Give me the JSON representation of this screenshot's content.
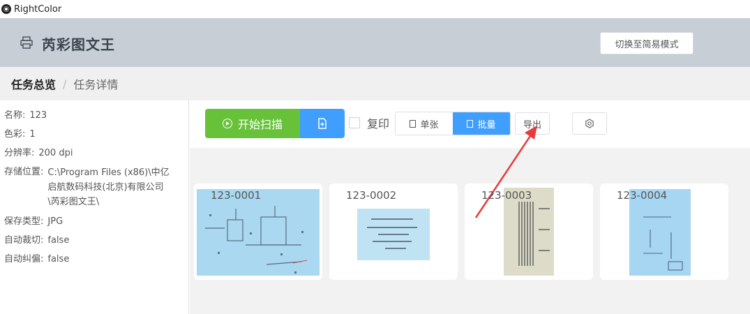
{
  "window": {
    "title": "RightColor"
  },
  "header": {
    "brand": "芮彩图文王",
    "mode_button": "切换至简易模式"
  },
  "breadcrumb": {
    "active": "任务总览",
    "separator": "/",
    "current": "任务详情"
  },
  "task_info": {
    "name_label": "名称:",
    "name_value": "123",
    "color_label": "色彩:",
    "color_value": "1",
    "resolution_label": "分辨率:",
    "resolution_value": "200 dpi",
    "storage_label": "存储位置:",
    "storage_value": "C:\\Program Files (x86)\\中亿启航数码科技(北京)有限公司\\芮彩图文王\\",
    "save_type_label": "保存类型:",
    "save_type_value": "JPG",
    "auto_crop_label": "自动裁切:",
    "auto_crop_value": "false",
    "auto_deskew_label": "自动纠偏:",
    "auto_deskew_value": "false"
  },
  "toolbar": {
    "scan_label": "开始扫描",
    "duplicate_label": "复印",
    "single_label": "单张",
    "batch_label": "批量",
    "export_label": "导出",
    "batch_active": true
  },
  "gallery": {
    "items": [
      {
        "label": "123-0001",
        "paper_color": "#a9d8f0"
      },
      {
        "label": "123-0002",
        "paper_color": "#bfe3f3"
      },
      {
        "label": "123-0003",
        "paper_color": "#dcdcc8"
      },
      {
        "label": "123-0004",
        "paper_color": "#a6d6f2"
      }
    ]
  },
  "colors": {
    "header_bg": "#c7ced6",
    "scan_green": "#67c23a",
    "primary_blue": "#409eff",
    "annotation_red": "#e83a3a"
  }
}
